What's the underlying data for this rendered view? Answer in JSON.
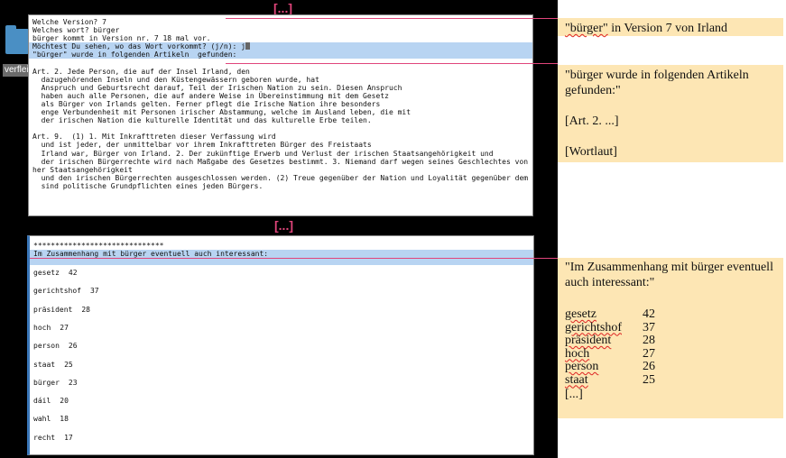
{
  "ellipsis_top": "[...]",
  "ellipsis_mid": "[...]",
  "desktop_icon_label": "verflei",
  "terminal1": {
    "lines": [
      {
        "text": "Welche Version? 7",
        "highlight": false
      },
      {
        "text": "Welches wort? bürger",
        "highlight": false
      },
      {
        "text": "bürger kommt in Version nr. 7 18 mal vor.",
        "highlight": false
      },
      {
        "text": "Möchtest Du sehen, wo das Wort vorkommt? (j/n): j",
        "highlight": true
      },
      {
        "text": "\"bürger\" wurde in folgenden Artikeln  gefunden:",
        "highlight": true
      },
      {
        "text": "",
        "highlight": false
      },
      {
        "text": "Art. 2. Jede Person, die auf der Insel Irland, den",
        "highlight": false
      },
      {
        "text": "  dazugehörenden Inseln und den Küstengewässern geboren wurde, hat",
        "highlight": false
      },
      {
        "text": "  Anspruch und Geburtsrecht darauf, Teil der Irischen Nation zu sein. Diesen Anspruch",
        "highlight": false
      },
      {
        "text": "  haben auch alle Personen, die auf andere Weise in Übereinstimmung mit dem Gesetz",
        "highlight": false
      },
      {
        "text": "  als Bürger von Irlands gelten. Ferner pflegt die Irische Nation ihre besonders",
        "highlight": false
      },
      {
        "text": "  enge Verbundenheit mit Personen irischer Abstammung, welche im Ausland leben, die mit",
        "highlight": false
      },
      {
        "text": "  der irischen Nation die kulturelle Identität und das kulturelle Erbe teilen.",
        "highlight": false
      },
      {
        "text": "",
        "highlight": false
      },
      {
        "text": "Art. 9.  (1) 1. Mit Inkrafttreten dieser Verfassung wird",
        "highlight": false
      },
      {
        "text": "  und ist jeder, der unmittelbar vor ihrem Inkrafttreten Bürger des Freistaats",
        "highlight": false
      },
      {
        "text": "  Irland war, Bürger von Irland. 2. Der zukünftige Erwerb und Verlust der irischen Staatsangehörigkeit und",
        "highlight": false
      },
      {
        "text": "  der irischen Bürgerrechte wird nach Maßgabe des Gesetzes bestimmt. 3. Niemand darf wegen seines Geschlechtes von der irisc",
        "highlight": false
      },
      {
        "text": "her Staatsangehörigkeit",
        "highlight": false
      },
      {
        "text": "  und den irischen Bürgerrechten ausgeschlossen werden. (2) Treue gegenüber der Nation und Loyalität gegenüber dem Staate",
        "highlight": false
      },
      {
        "text": "  sind politische Grundpflichten eines jeden Bürgers.",
        "highlight": false
      }
    ]
  },
  "terminal2": {
    "stars": "******************************",
    "heading": "Im Zusammenhang mit bürger eventuell auch interessant:",
    "rows": [
      {
        "word": "gesetz",
        "count": "42"
      },
      {
        "word": "gerichtshof",
        "count": "37"
      },
      {
        "word": "präsident",
        "count": "28"
      },
      {
        "word": "hoch",
        "count": "27"
      },
      {
        "word": "person",
        "count": "26"
      },
      {
        "word": "staat",
        "count": "25"
      },
      {
        "word": "bürger",
        "count": "23"
      },
      {
        "word": "dáil",
        "count": "20"
      },
      {
        "word": "wahl",
        "count": "18"
      },
      {
        "word": "recht",
        "count": "17"
      }
    ]
  },
  "annotations": {
    "a1_quote_word": "\"bürger\"",
    "a1_rest": " in Version 7 von Irland",
    "a2_line1": "\"bürger wurde in folgenden Artikeln gefunden:\"",
    "a2_line2": "[Art. 2. ...]",
    "a2_line3": "[Wortlaut]",
    "a3_heading": "\"Im Zusammenhang mit bürger eventuell auch interessant:\"",
    "a3_rows": [
      {
        "word": "gesetz",
        "count": "42"
      },
      {
        "word": "gerichtshof",
        "count": "37"
      },
      {
        "word": "präsident",
        "count": "28"
      },
      {
        "word": "hoch",
        "count": "27"
      },
      {
        "word": "person",
        "count": "26"
      },
      {
        "word": "staat",
        "count": "25"
      }
    ],
    "a3_more": "[...]"
  },
  "colors": {
    "highlight": "#b8d4f2",
    "annotation_bg": "#fde6b4",
    "connector": "#e0457b"
  }
}
